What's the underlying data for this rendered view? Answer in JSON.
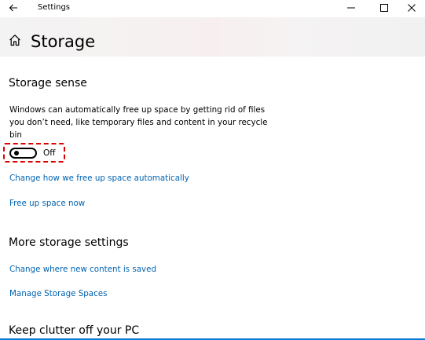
{
  "titlebar": {
    "title": "Settings"
  },
  "header": {
    "title": "Storage"
  },
  "storage_sense": {
    "heading": "Storage sense",
    "description": "Windows can automatically free up space by getting rid of files you don’t need, like temporary files and content in your recycle bin",
    "toggle": {
      "on": false,
      "label": "Off"
    },
    "links": {
      "change_free_up": "Change how we free up space automatically",
      "free_up_now": "Free up space now"
    }
  },
  "more_storage": {
    "heading": "More storage settings",
    "links": {
      "change_saved": "Change where new content is saved",
      "manage_spaces": "Manage Storage Spaces"
    }
  },
  "keep_clutter": {
    "heading": "Keep clutter off your PC"
  },
  "colors": {
    "link": "#0063b1",
    "highlight": "#d90000",
    "accent": "#0078d7"
  }
}
